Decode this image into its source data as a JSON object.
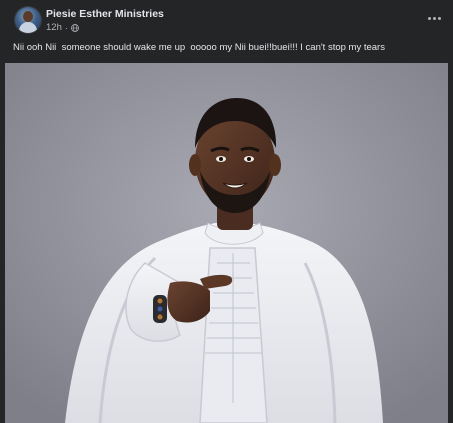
{
  "post": {
    "page_name": "Piesie Esther Ministries",
    "timestamp": "12h",
    "separator": "·",
    "audience_icon": "globe-icon",
    "more_icon": "more-options-icon",
    "text": "Nii ooh Nii  someone should wake me up  ooooo my Nii buei!!buei!!! I can't stop my tears"
  },
  "colors": {
    "background": "#242526",
    "primary_text": "#e4e6eb",
    "secondary_text": "#b0b3b8"
  }
}
